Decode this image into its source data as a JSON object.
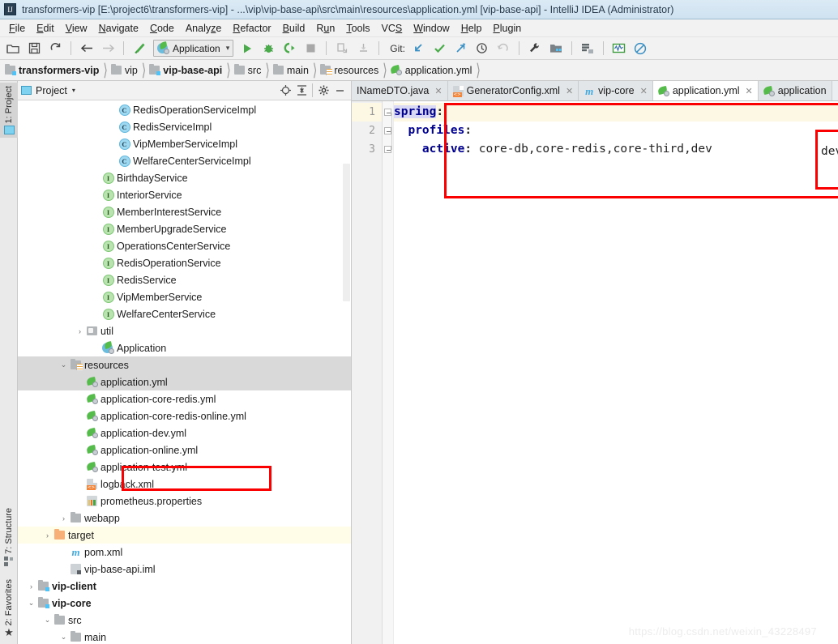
{
  "window": {
    "title": "transformers-vip [E:\\project6\\transformers-vip] - ...\\vip\\vip-base-api\\src\\main\\resources\\application.yml [vip-base-api] - IntelliJ IDEA (Administrator)",
    "logo": "idea-logo-icon"
  },
  "menu": {
    "items": [
      {
        "label": "File"
      },
      {
        "label": "Edit"
      },
      {
        "label": "View"
      },
      {
        "label": "Navigate"
      },
      {
        "label": "Code"
      },
      {
        "label": "Analyze"
      },
      {
        "label": "Refactor"
      },
      {
        "label": "Build"
      },
      {
        "label": "Run"
      },
      {
        "label": "Tools"
      },
      {
        "label": "VCS"
      },
      {
        "label": "Window"
      },
      {
        "label": "Help"
      },
      {
        "label": "Plugin"
      }
    ]
  },
  "toolbar": {
    "run_config": "Application",
    "git_label": "Git:",
    "icons": [
      "open-folder-icon",
      "save-icon",
      "sync-icon",
      "back-arrow-icon",
      "forward-arrow-icon",
      "build-hammer-icon",
      "run-icon",
      "debug-icon",
      "run-with-coverage-icon",
      "stop-icon",
      "attach-profiler-icon",
      "attach-debugger-icon",
      "vcs-update-icon",
      "vcs-commit-icon",
      "vcs-push-icon",
      "vcs-history-icon",
      "vcs-rollback-icon",
      "settings-wrench-icon",
      "project-structure-icon",
      "database-icon",
      "monitor-icon",
      "no-entry-icon"
    ]
  },
  "breadcrumb": {
    "items": [
      {
        "label": "transformers-vip",
        "icon": "module-folder-icon",
        "bold": true
      },
      {
        "label": "vip",
        "icon": "folder-icon",
        "bold": false
      },
      {
        "label": "vip-base-api",
        "icon": "module-folder-icon",
        "bold": true
      },
      {
        "label": "src",
        "icon": "folder-icon",
        "bold": false
      },
      {
        "label": "main",
        "icon": "folder-icon",
        "bold": false
      },
      {
        "label": "resources",
        "icon": "resources-folder-icon",
        "bold": false
      },
      {
        "label": "application.yml",
        "icon": "yml-file-icon",
        "bold": false
      }
    ]
  },
  "left_tool_strip": {
    "tabs": [
      {
        "label": "1: Project",
        "icon": "project-window-icon",
        "active": true
      },
      {
        "label": "7: Structure",
        "icon": "structure-icon",
        "active": false
      },
      {
        "label": "2: Favorites",
        "icon": "star-icon",
        "active": false
      }
    ]
  },
  "project_panel": {
    "title": "Project",
    "caret": "▾",
    "buttons": [
      "locate-target-icon",
      "collapse-all-icon",
      "settings-gear-icon",
      "minimize-icon"
    ],
    "tree": [
      {
        "indent": 5,
        "arrow": "",
        "icon": "class-icon",
        "label": "RedisOperationServiceImpl",
        "bold": false
      },
      {
        "indent": 5,
        "arrow": "",
        "icon": "class-icon",
        "label": "RedisServiceImpl",
        "bold": false
      },
      {
        "indent": 5,
        "arrow": "",
        "icon": "class-icon",
        "label": "VipMemberServiceImpl",
        "bold": false
      },
      {
        "indent": 5,
        "arrow": "",
        "icon": "class-icon",
        "label": "WelfareCenterServiceImpl",
        "bold": false
      },
      {
        "indent": 4,
        "arrow": "",
        "icon": "interface-icon",
        "label": "BirthdayService",
        "bold": false
      },
      {
        "indent": 4,
        "arrow": "",
        "icon": "interface-icon",
        "label": "InteriorService",
        "bold": false
      },
      {
        "indent": 4,
        "arrow": "",
        "icon": "interface-icon",
        "label": "MemberInterestService",
        "bold": false
      },
      {
        "indent": 4,
        "arrow": "",
        "icon": "interface-icon",
        "label": "MemberUpgradeService",
        "bold": false
      },
      {
        "indent": 4,
        "arrow": "",
        "icon": "interface-icon",
        "label": "OperationsCenterService",
        "bold": false
      },
      {
        "indent": 4,
        "arrow": "",
        "icon": "interface-icon",
        "label": "RedisOperationService",
        "bold": false
      },
      {
        "indent": 4,
        "arrow": "",
        "icon": "interface-icon",
        "label": "RedisService",
        "bold": false
      },
      {
        "indent": 4,
        "arrow": "",
        "icon": "interface-icon",
        "label": "VipMemberService",
        "bold": false
      },
      {
        "indent": 4,
        "arrow": "",
        "icon": "interface-icon",
        "label": "WelfareCenterService",
        "bold": false
      },
      {
        "indent": 3,
        "arrow": "›",
        "icon": "folder-open-icon",
        "label": "util",
        "bold": false
      },
      {
        "indent": 4,
        "arrow": "",
        "icon": "spring-app-icon",
        "label": "Application",
        "bold": false
      },
      {
        "indent": 2,
        "arrow": "⌄",
        "icon": "resources-folder-icon",
        "label": "resources",
        "bold": false,
        "state": "selected"
      },
      {
        "indent": 3,
        "arrow": "",
        "icon": "yml-file-icon",
        "label": "application.yml",
        "bold": false,
        "state": "selected",
        "highlight": "red-box"
      },
      {
        "indent": 3,
        "arrow": "",
        "icon": "yml-file-icon",
        "label": "application-core-redis.yml",
        "bold": false
      },
      {
        "indent": 3,
        "arrow": "",
        "icon": "yml-file-icon",
        "label": "application-core-redis-online.yml",
        "bold": false
      },
      {
        "indent": 3,
        "arrow": "",
        "icon": "yml-file-icon",
        "label": "application-dev.yml",
        "bold": false
      },
      {
        "indent": 3,
        "arrow": "",
        "icon": "yml-file-icon",
        "label": "application-online.yml",
        "bold": false
      },
      {
        "indent": 3,
        "arrow": "",
        "icon": "yml-file-icon",
        "label": "application-test.yml",
        "bold": false
      },
      {
        "indent": 3,
        "arrow": "",
        "icon": "xml-file-icon",
        "label": "logback.xml",
        "bold": false
      },
      {
        "indent": 3,
        "arrow": "",
        "icon": "properties-file-icon",
        "label": "prometheus.properties",
        "bold": false
      },
      {
        "indent": 2,
        "arrow": "›",
        "icon": "folder-icon",
        "label": "webapp",
        "bold": false
      },
      {
        "indent": 1,
        "arrow": "›",
        "icon": "target-folder-icon",
        "label": "target",
        "bold": false,
        "state": "target-row"
      },
      {
        "indent": 2,
        "arrow": "",
        "icon": "maven-icon",
        "label": "pom.xml",
        "bold": false
      },
      {
        "indent": 2,
        "arrow": "",
        "icon": "iml-file-icon",
        "label": "vip-base-api.iml",
        "bold": false
      },
      {
        "indent": 0,
        "arrow": "›",
        "icon": "module-folder-icon",
        "label": "vip-client",
        "bold": true
      },
      {
        "indent": 0,
        "arrow": "⌄",
        "icon": "module-folder-icon",
        "label": "vip-core",
        "bold": true
      },
      {
        "indent": 1,
        "arrow": "⌄",
        "icon": "folder-icon",
        "label": "src",
        "bold": false
      },
      {
        "indent": 2,
        "arrow": "⌄",
        "icon": "folder-icon",
        "label": "main",
        "bold": false
      }
    ]
  },
  "editor": {
    "tabs": [
      {
        "label": "INameDTO.java",
        "icon": "java-file-icon",
        "active": false,
        "closable": true
      },
      {
        "label": "GeneratorConfig.xml",
        "icon": "xml-file-icon",
        "active": false,
        "closable": true
      },
      {
        "label": "vip-core",
        "icon": "maven-icon",
        "active": false,
        "closable": true
      },
      {
        "label": "application.yml",
        "icon": "yml-file-icon",
        "active": true,
        "closable": true
      },
      {
        "label": "application",
        "icon": "yml-file-icon",
        "active": false,
        "closable": false
      }
    ],
    "line_numbers": [
      "1",
      "2",
      "3"
    ],
    "current_line": 1,
    "code": [
      {
        "indent": 0,
        "key": "spring",
        "value": "",
        "key_selected": true
      },
      {
        "indent": 2,
        "key": "profiles",
        "value": "",
        "key_selected": false
      },
      {
        "indent": 4,
        "key": "active",
        "value": " core-db,core-redis,core-third,dev",
        "key_selected": false
      }
    ],
    "annotations": [
      {
        "name": "editor-red-box",
        "target": "code block lines 1-3"
      },
      {
        "name": "dev-profile-red-box",
        "target": "dev"
      }
    ]
  },
  "watermark": {
    "text": "https://blog.csdn.net/weixin_43228497"
  },
  "colors": {
    "accent_blue": "#2a6fb0",
    "title_bar": "#cfe2f0",
    "annotation_red": "#fb0000",
    "keyword_navy": "#00008f",
    "current_line": "#fdf8e3",
    "selection": "#d9d9d9",
    "spring_green": "#55bb4a"
  }
}
